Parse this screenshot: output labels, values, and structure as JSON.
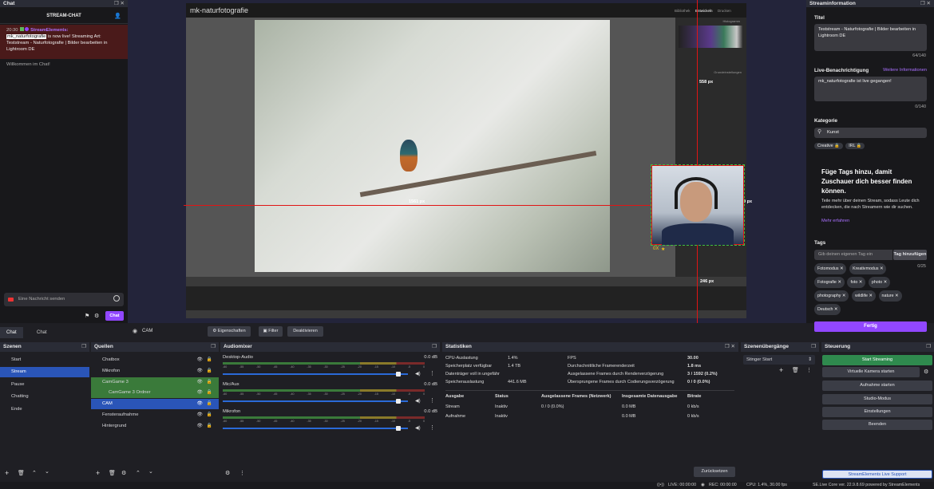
{
  "chat": {
    "dock_title": "Chat",
    "header": "STREAM-CHAT",
    "msg_time": "20:30",
    "msg_sender": "StreamElements:",
    "msg_mention": "mk_naturfotografie",
    "msg_text": " is now live! Streaming Art: Teststream - Naturfotografie | Bilder bearbeiten in Lightroom DE",
    "welcome": "Willkommen im Chat!",
    "input_placeholder": "Eine Nachricht senden",
    "send_label": "Chat",
    "tabs": [
      "Chat",
      "Chat"
    ]
  },
  "preview": {
    "lr_title": "mk-naturfotografie",
    "lr_modules": [
      "Bibliothek",
      "Entwickeln",
      "Drucken"
    ],
    "lr_panel_title": "Histogramm",
    "lr_section": "Grundeinstellungen",
    "measure_top": "558 px",
    "measure_left": "1561 px",
    "measure_right": "20 px",
    "measure_bottom": "246 px",
    "cam_label": "0X"
  },
  "source_toolbar": {
    "source_name": "CAM",
    "properties_label": "Eigenschaften",
    "filter_label": "Filter",
    "deactivate_label": "Deaktivieren"
  },
  "stream_info": {
    "dock_title": "Streaminformation",
    "title_label": "Titel",
    "title_value": "Teststream - Naturfotografie | Bilder bearbeiten in Lightroom DE",
    "title_counter": "64/140",
    "notify_label": "Live-Benachrichtigung",
    "notify_more": "Weitere Informationen",
    "notify_value": "mk_naturfotografie ist live gegangen!",
    "notify_counter": "0/140",
    "category_label": "Kategorie",
    "category_value": "Kunst",
    "category_tags": [
      "Creative",
      "IRL"
    ],
    "promo_title": "Füge Tags hinzu, damit Zuschauer dich besser finden können.",
    "promo_text": "Teile mehr über deinen Stream, sodass Leute dich entdecken, die nach Streamern wie dir suchen.",
    "promo_link": "Mehr erfahren",
    "tags_label": "Tags",
    "tags_placeholder": "Gib deinen eigenen Tag ein",
    "tags_add": "Tag hinzufügen",
    "tags_counter": "0/25",
    "tags": [
      "Fotomodus",
      "Kreativmodus",
      "Fotografie",
      "foto",
      "photo",
      "photography",
      "wildlife",
      "nature",
      "Deutsch"
    ],
    "done_label": "Fertig"
  },
  "scenes": {
    "title": "Szenen",
    "items": [
      "Start",
      "Stream",
      "Pause",
      "Chatting",
      "Ende"
    ]
  },
  "sources": {
    "title": "Quellen",
    "items": [
      "Chatbox",
      "Mikrofon",
      "CamGame 3",
      "CamGame 3 Ordner",
      "CAM",
      "Fensteraufnahme",
      "Hintergrund"
    ]
  },
  "mixer": {
    "title": "Audiomixer",
    "channels": [
      {
        "name": "Desktop-Audio",
        "db": "0.0 dB",
        "level": 0.95
      },
      {
        "name": "Mic/Aux",
        "db": "0.0 dB",
        "level": 0.95
      },
      {
        "name": "Mikrofon",
        "db": "0.0 dB",
        "level": 0.95
      }
    ],
    "scale": [
      "-60",
      "-55",
      "-50",
      "-45",
      "-40",
      "-35",
      "-30",
      "-25",
      "-20",
      "-15",
      "-10",
      "-5",
      "0"
    ]
  },
  "stats": {
    "title": "Statistiken",
    "left": [
      [
        "CPU-Auslastung",
        "1.4%"
      ],
      [
        "Speicherplatz verfügbar",
        "1.4 TB"
      ],
      [
        "Datenträger voll in ungefähr",
        ""
      ],
      [
        "Speicherauslastung",
        "441.6 MB"
      ]
    ],
    "right": [
      [
        "FPS",
        "30.00"
      ],
      [
        "Durchschnittliche Framerenderzeit",
        "1.8 ms"
      ],
      [
        "Ausgelassene Frames durch Renderverzögerung",
        "3 / 1592 (0.2%)"
      ],
      [
        "Übersprungene Frames durch Codierungsverzögerung",
        "0 / 0 (0.0%)"
      ]
    ],
    "table_headers": [
      "Ausgabe",
      "Status",
      "Ausgelassene Frames (Netzwerk)",
      "Insgesamte Datenausgabe",
      "Bitrate"
    ],
    "rows": [
      [
        "Stream",
        "Inaktiv",
        "0 / 0 (0.0%)",
        "0.0 MB",
        "0 kb/s"
      ],
      [
        "Aufnahme",
        "Inaktiv",
        "",
        "0.0 MB",
        "0 kb/s"
      ]
    ],
    "reset_label": "Zurücksetzen"
  },
  "transitions": {
    "title": "Szenenübergänge",
    "value": "Stinger Start"
  },
  "controls": {
    "title": "Steuerung",
    "start_stream": "Start Streaming",
    "virtual_cam": "Virtuelle Kamera starten",
    "start_record": "Aufnahme starten",
    "studio_mode": "Studio-Modus",
    "settings": "Einstellungen",
    "exit": "Beenden",
    "se_support": "StreamElements Live Support"
  },
  "statusbar": {
    "live": "LIVE: 00:00:00",
    "rec": "REC: 00:00:00",
    "cpu": "CPU: 1.4%, 30.00 fps",
    "version": "SE.Live Core ver. 22.9.8.69 powered by StreamElements"
  },
  "colors": {
    "accent_purple": "#7b4bff",
    "start_green": "#2f8a4e",
    "scene_selected": "#2a55b8",
    "source_green": "#3a7a3a",
    "source_blue": "#2a55b8"
  }
}
